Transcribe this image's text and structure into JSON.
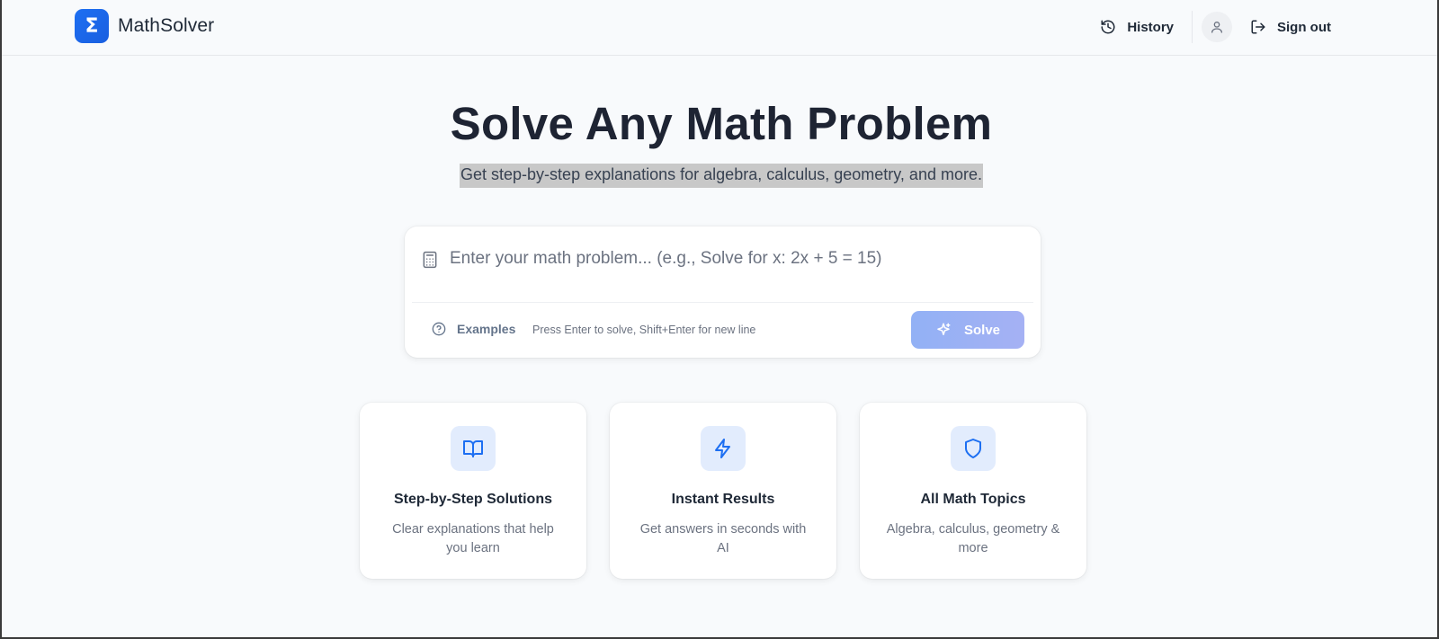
{
  "header": {
    "logo_symbol": "Σ",
    "brand": "MathSolver",
    "history_label": "History",
    "signout_label": "Sign out"
  },
  "hero": {
    "title": "Solve Any Math Problem",
    "subtitle": "Get step-by-step explanations for algebra, calculus, geometry, and more."
  },
  "input": {
    "value": "",
    "placeholder": "Enter your math problem... (e.g., Solve for x: 2x + 5 = 15)",
    "examples_label": "Examples",
    "hint": "Press Enter to solve, Shift+Enter for new line",
    "solve_label": "Solve"
  },
  "features": [
    {
      "icon": "book-open-icon",
      "title": "Step-by-Step Solutions",
      "description": "Clear explanations that help you learn"
    },
    {
      "icon": "lightning-icon",
      "title": "Instant Results",
      "description": "Get answers in seconds with AI"
    },
    {
      "icon": "shield-icon",
      "title": "All Math Topics",
      "description": "Algebra, calculus, geometry & more"
    }
  ],
  "colors": {
    "brand": "#1d6ff2",
    "solve_button": "#9db1f5",
    "feature_icon_bg": "#e2ecfd",
    "feature_icon": "#1d6ff2",
    "background": "#f8fafc"
  }
}
